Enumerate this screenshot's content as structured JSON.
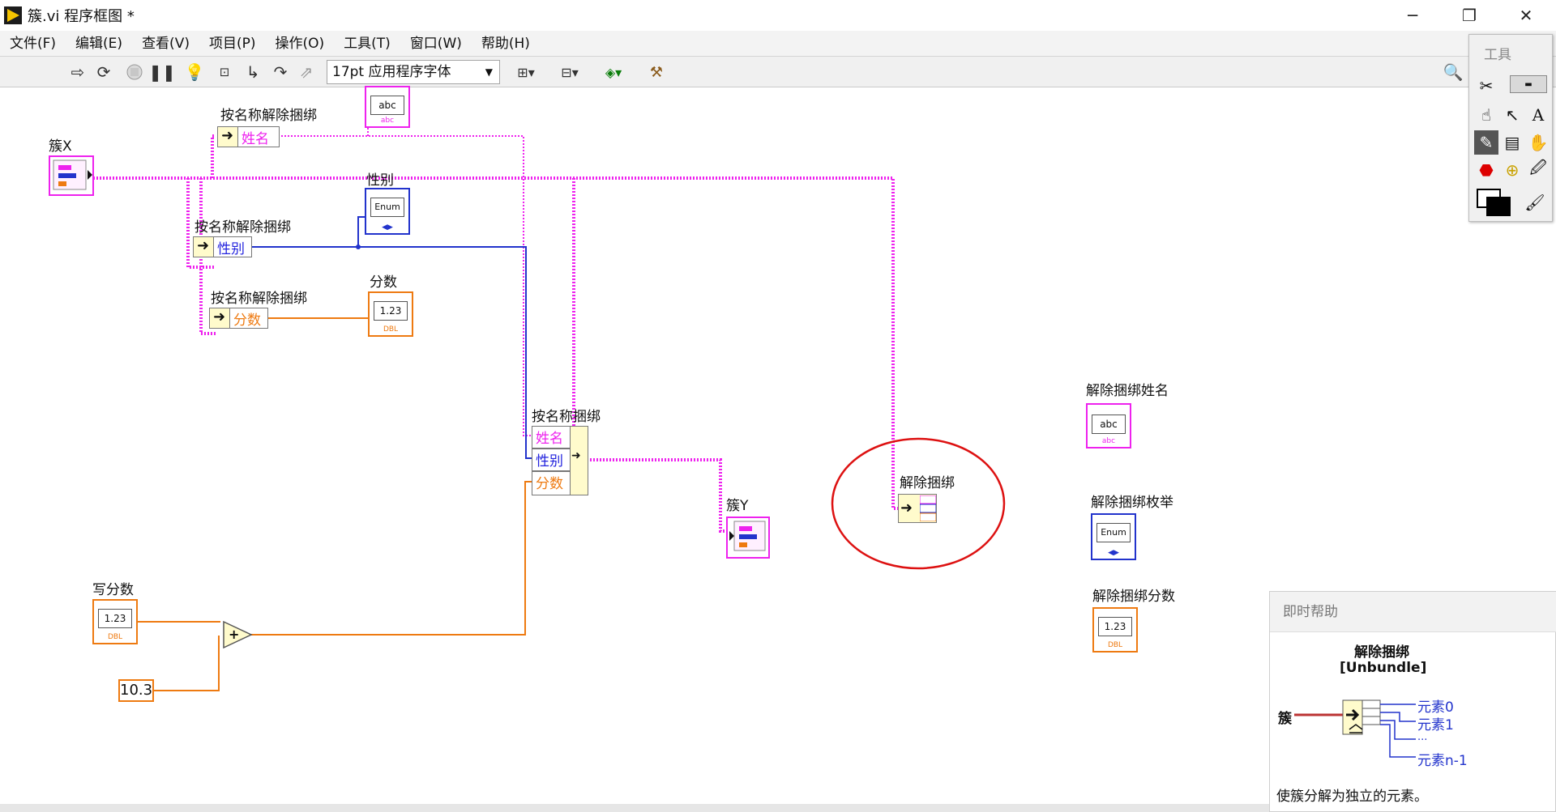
{
  "window": {
    "title": "簇.vi 程序框图 *"
  },
  "menu": [
    "文件(F)",
    "编辑(E)",
    "查看(V)",
    "项目(P)",
    "操作(O)",
    "工具(T)",
    "窗口(W)",
    "帮助(H)"
  ],
  "toolbar": {
    "font": "17pt 应用程序字体"
  },
  "tools_palette": {
    "title": "工具"
  },
  "diagram": {
    "cluster_x_label": "簇X",
    "cluster_y_label": "簇Y",
    "unbundle_by_name_1": "按名称解除捆绑",
    "unbundle_by_name_2": "按名称解除捆绑",
    "unbundle_by_name_3": "按名称解除捆绑",
    "field_name": "姓名",
    "field_gender": "性别",
    "field_score": "分数",
    "ind_gender_label": "性别",
    "ind_score_label": "分数",
    "bundle_by_name_label": "按名称捆绑",
    "bundle_fields": [
      "姓名",
      "性别",
      "分数"
    ],
    "write_score_label": "写分数",
    "constant_value": "10.3",
    "add_symbol": "+",
    "unbundle_label": "解除捆绑",
    "unbundle_name_label": "解除捆绑姓名",
    "unbundle_enum_label": "解除捆绑枚举",
    "unbundle_score_label": "解除捆绑分数",
    "term_str": "abc",
    "term_enum": "Enum",
    "term_num": "1.23",
    "tag_dbl": "DBL",
    "tag_abc": "abc"
  },
  "context_help": {
    "title": "即时帮助",
    "node_name": "解除捆绑",
    "node_en": "[Unbundle]",
    "input_label": "簇",
    "outputs": [
      "元素0",
      "元素1",
      "...",
      "元素n-1"
    ],
    "description": "使簇分解为独立的元素。"
  },
  "colors": {
    "cluster_wire": "#ee22ee",
    "enum_wire": "#2233cc",
    "dbl_wire": "#ee7a11",
    "highlight_circle": "#dd1111"
  }
}
